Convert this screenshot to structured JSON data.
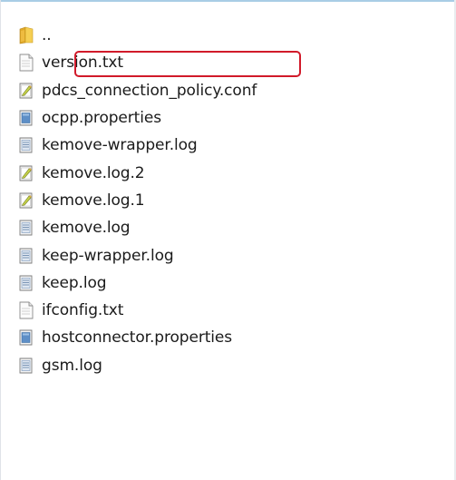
{
  "file_list": {
    "items": [
      {
        "name": "..",
        "icon": "folder-up-icon"
      },
      {
        "name": "version.txt",
        "icon": "text-file-icon"
      },
      {
        "name": "pdcs_connection_policy.conf",
        "icon": "config-file-icon"
      },
      {
        "name": "ocpp.properties",
        "icon": "properties-file-icon"
      },
      {
        "name": "kemove-wrapper.log",
        "icon": "log-file-icon"
      },
      {
        "name": "kemove.log.2",
        "icon": "config-file-icon"
      },
      {
        "name": "kemove.log.1",
        "icon": "config-file-icon"
      },
      {
        "name": "kemove.log",
        "icon": "log-file-icon"
      },
      {
        "name": "keep-wrapper.log",
        "icon": "log-file-icon"
      },
      {
        "name": "keep.log",
        "icon": "log-file-icon"
      },
      {
        "name": "ifconfig.txt",
        "icon": "text-file-icon"
      },
      {
        "name": "hostconnector.properties",
        "icon": "properties-file-icon"
      },
      {
        "name": "gsm.log",
        "icon": "log-file-icon"
      }
    ]
  },
  "highlight": {
    "target": "version.txt",
    "color": "#d11a2a"
  }
}
